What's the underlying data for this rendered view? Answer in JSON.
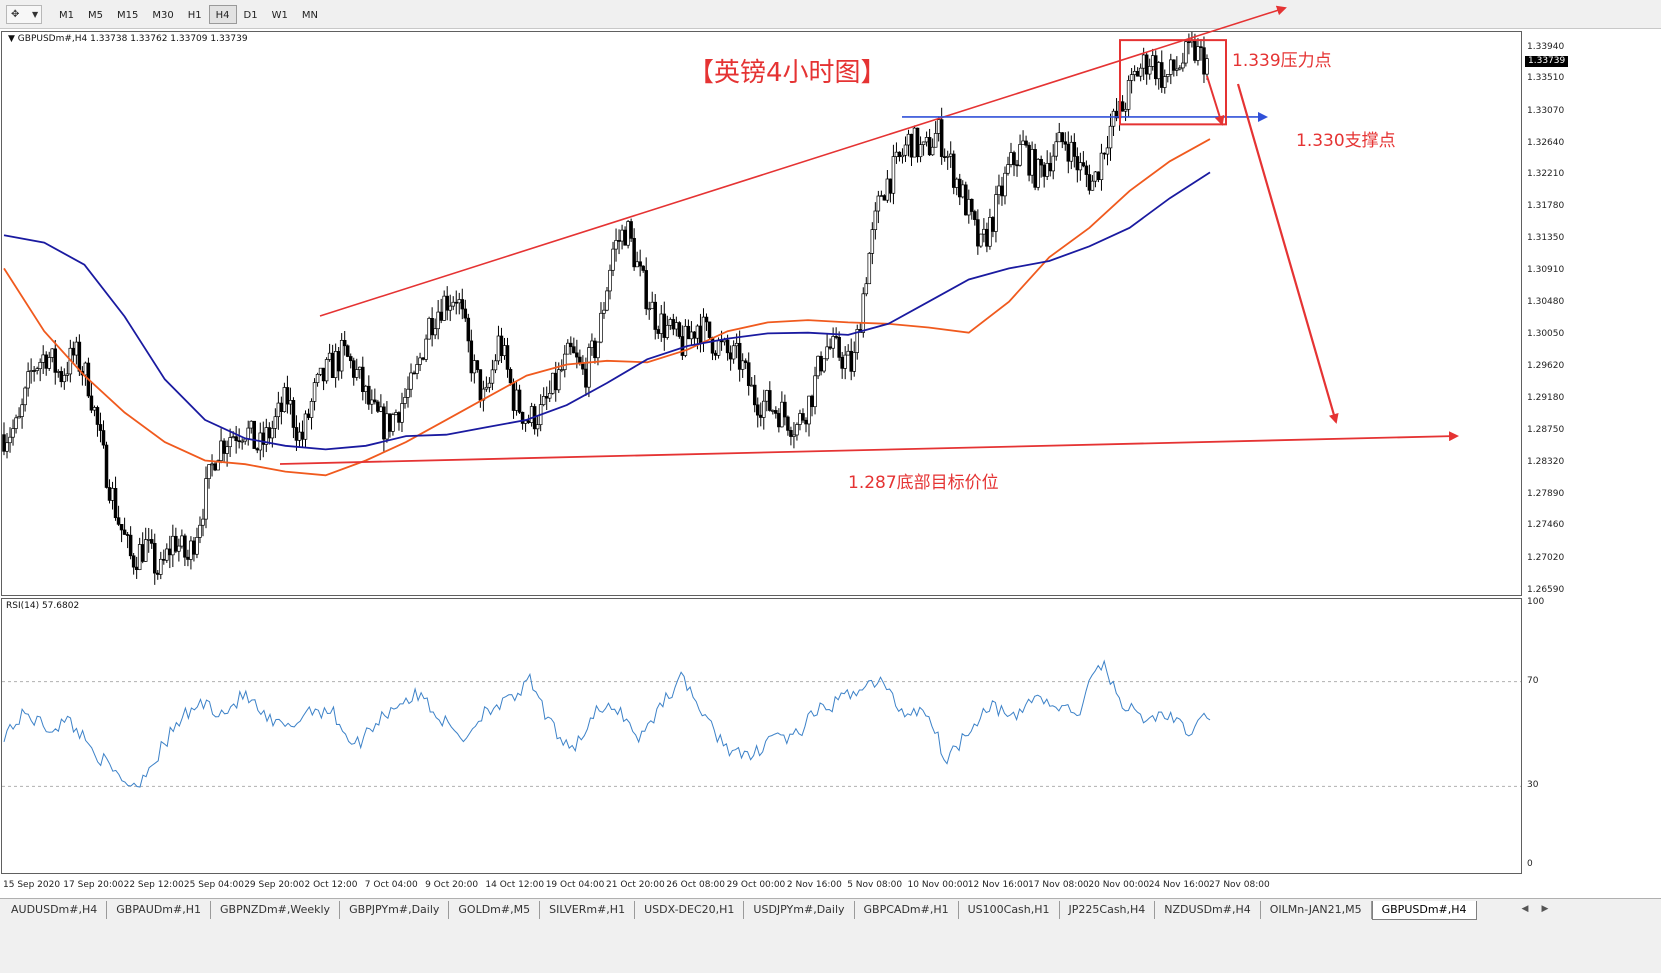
{
  "toolbar": {
    "tool_icon": "crosshair-cursor-icon",
    "timeframes": [
      "M1",
      "M5",
      "M15",
      "M30",
      "H1",
      "H4",
      "D1",
      "W1",
      "MN"
    ],
    "active_timeframe": "H4"
  },
  "chart": {
    "symbol_info": "GBPUSDm#,H4  1.33738 1.33762 1.33709 1.33739",
    "current_price": "1.33739",
    "price_ticks": [
      "1.33940",
      "1.33510",
      "1.33070",
      "1.32640",
      "1.32210",
      "1.31780",
      "1.31350",
      "1.30910",
      "1.30480",
      "1.30050",
      "1.29620",
      "1.29180",
      "1.28750",
      "1.28320",
      "1.27890",
      "1.27460",
      "1.27020",
      "1.26590"
    ],
    "time_ticks": [
      "15 Sep 2020",
      "17 Sep 20:00",
      "22 Sep 12:00",
      "25 Sep 04:00",
      "29 Sep 20:00",
      "2 Oct 12:00",
      "7 Oct 04:00",
      "9 Oct 20:00",
      "14 Oct 12:00",
      "19 Oct 04:00",
      "21 Oct 20:00",
      "26 Oct 08:00",
      "29 Oct 00:00",
      "2 Nov 16:00",
      "5 Nov 08:00",
      "10 Nov 00:00",
      "12 Nov 16:00",
      "17 Nov 08:00",
      "20 Nov 00:00",
      "24 Nov 16:00",
      "27 Nov 08:00"
    ],
    "colors": {
      "ma_fast": "#f05a1e",
      "ma_slow": "#1a1aa0",
      "annotation": "#e53333",
      "support_line": "#3050d8",
      "rsi_line": "#3d82c8"
    }
  },
  "rsi": {
    "info": "RSI(14) 57.6802",
    "ticks": [
      "100",
      "70",
      "30",
      "0"
    ]
  },
  "annotations": {
    "title": "【英镑4小时图】",
    "resistance": "1.339压力点",
    "support": "1.330支撑点",
    "target": "1.287底部目标价位"
  },
  "tabs": {
    "items": [
      "AUDUSDm#,H4",
      "GBPAUDm#,H1",
      "GBPNZDm#,Weekly",
      "GBPJPYm#,Daily",
      "GOLDm#,M5",
      "SILVERm#,H1",
      "USDX-DEC20,H1",
      "USDJPYm#,Daily",
      "GBPCADm#,H1",
      "US100Cash,H1",
      "JP225Cash,H4",
      "NZDUSDm#,H4",
      "OILMn-JAN21,M5",
      "GBPUSDm#,H4"
    ],
    "active": "GBPUSDm#,H4"
  },
  "chart_data": {
    "type": "candlestick",
    "symbol": "GBPUSDm#",
    "timeframe": "H4",
    "ohlc_last": {
      "open": 1.33738,
      "high": 1.33762,
      "low": 1.33709,
      "close": 1.33739
    },
    "ylim": [
      1.2653,
      1.3415
    ],
    "y_ticks": [
      1.3394,
      1.3351,
      1.3307,
      1.3264,
      1.3221,
      1.3178,
      1.3135,
      1.3091,
      1.3048,
      1.3005,
      1.2962,
      1.2918,
      1.2875,
      1.2832,
      1.2789,
      1.2746,
      1.2702,
      1.2659
    ],
    "x_ticks": [
      "15 Sep 2020",
      "17 Sep 20:00",
      "22 Sep 12:00",
      "25 Sep 04:00",
      "29 Sep 20:00",
      "2 Oct 12:00",
      "7 Oct 04:00",
      "9 Oct 20:00",
      "14 Oct 12:00",
      "19 Oct 04:00",
      "21 Oct 20:00",
      "26 Oct 08:00",
      "29 Oct 00:00",
      "2 Nov 16:00",
      "5 Nov 08:00",
      "10 Nov 00:00",
      "12 Nov 16:00",
      "17 Nov 08:00",
      "20 Nov 00:00",
      "24 Nov 16:00",
      "27 Nov 08:00"
    ],
    "close_path": [
      1.287,
      1.288,
      1.296,
      1.298,
      1.295,
      1.298,
      1.294,
      1.284,
      1.276,
      1.27,
      1.272,
      1.268,
      1.273,
      1.27,
      1.277,
      1.285,
      1.287,
      1.288,
      1.285,
      1.288,
      1.292,
      1.286,
      1.293,
      1.296,
      1.298,
      1.295,
      1.29,
      1.288,
      1.291,
      1.294,
      1.302,
      1.305,
      1.306,
      1.297,
      1.291,
      1.3,
      1.292,
      1.289,
      1.29,
      1.294,
      1.298,
      1.295,
      1.3,
      1.312,
      1.315,
      1.308,
      1.303,
      1.301,
      1.299,
      1.302,
      1.3,
      1.298,
      1.297,
      1.292,
      1.291,
      1.29,
      1.288,
      1.292,
      1.299,
      1.298,
      1.296,
      1.31,
      1.32,
      1.323,
      1.327,
      1.325,
      1.328,
      1.323,
      1.318,
      1.312,
      1.317,
      1.323,
      1.326,
      1.322,
      1.325,
      1.327,
      1.323,
      1.321,
      1.328,
      1.331,
      1.336,
      1.338,
      1.335,
      1.337,
      1.339,
      1.3374
    ],
    "series": [
      {
        "name": "",
        "values": [
          1.3095,
          1.301,
          1.295,
          1.29,
          1.286,
          1.2835,
          1.283,
          1.282,
          1.2815,
          1.2835,
          1.286,
          1.289,
          1.292,
          1.295,
          1.2965,
          1.297,
          1.2968,
          1.2985,
          1.301,
          1.3022,
          1.3025,
          1.3022,
          1.302,
          1.3015,
          1.3008,
          1.305,
          1.311,
          1.315,
          1.32,
          1.324,
          1.327
        ]
      },
      {
        "name": "",
        "values": [
          1.314,
          1.313,
          1.31,
          1.303,
          1.2945,
          1.289,
          1.2865,
          1.2855,
          1.285,
          1.2855,
          1.2868,
          1.287,
          1.288,
          1.289,
          1.291,
          1.294,
          1.2972,
          1.299,
          1.3,
          1.3007,
          1.3008,
          1.3005,
          1.302,
          1.305,
          1.308,
          1.3095,
          1.3105,
          1.3125,
          1.315,
          1.319,
          1.3225
        ]
      }
    ],
    "rsi": {
      "name": "RSI(14)",
      "last": 57.6802,
      "ylim": [
        0,
        100
      ],
      "levels": [
        70,
        30
      ],
      "values": [
        50,
        58,
        52,
        55,
        45,
        35,
        30,
        42,
        55,
        62,
        58,
        65,
        55,
        52,
        60,
        58,
        45,
        55,
        62,
        65,
        55,
        48,
        60,
        62,
        70,
        52,
        45,
        58,
        60,
        48,
        62,
        72,
        55,
        45,
        40,
        50,
        48,
        58,
        62,
        68,
        70,
        58,
        60,
        40,
        52,
        62,
        55,
        65,
        60,
        58,
        78,
        62,
        55,
        58,
        50,
        58
      ]
    },
    "annotations": [
      {
        "label": "1.339压力点",
        "price": 1.339
      },
      {
        "label": "1.330支撑点",
        "price": 1.33
      },
      {
        "label": "1.287底部目标价位",
        "price": 1.287
      }
    ]
  }
}
